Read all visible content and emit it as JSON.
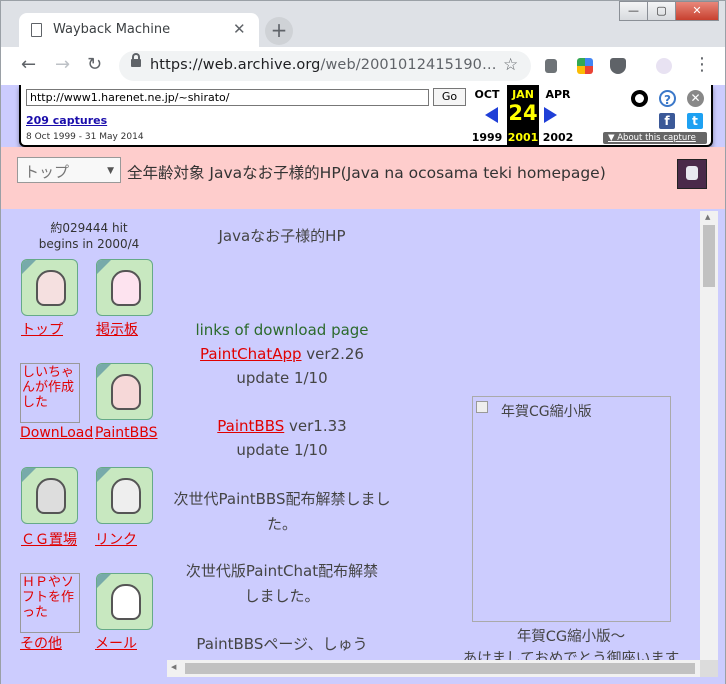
{
  "browser": {
    "tab_title": "Wayback Machine",
    "tab_close": "✕",
    "new_tab": "+",
    "window_min": "—",
    "window_max": "▢",
    "window_close": "✕",
    "back": "←",
    "forward": "→",
    "reload": "↻",
    "url_host": "https://web.archive.org",
    "url_path": "/web/2001012415190…",
    "star": "☆",
    "menu": "⋮"
  },
  "wayback": {
    "url_input": "http://www1.harenet.ne.jp/~shirato/",
    "go": "Go",
    "captures": "209 captures",
    "range": "8 Oct 1999 - 31 May 2014",
    "prev_month": "OCT",
    "prev_year": "1999",
    "cur_month": "JAN",
    "cur_day": "24",
    "cur_year": "2001",
    "next_month": "APR",
    "next_year": "2002",
    "about": "▼ About this capture",
    "help_icon": "?",
    "close_icon": "✕",
    "facebook": "f",
    "twitter": "t"
  },
  "page": {
    "select_value": "トップ",
    "title": "全年齢対象 Javaなお子様的HP(Java na ocosama teki homepage)",
    "hit_count": "約029444 hit",
    "begins": "begins in 2000/4",
    "nav": [
      {
        "label": "トップ"
      },
      {
        "label": "掲示板"
      },
      {
        "label": "DownLoad",
        "alt": "しいちゃんが作成した"
      },
      {
        "label": "PaintBBS"
      },
      {
        "label": "ＣＧ置場"
      },
      {
        "label": "リンク"
      },
      {
        "label": "その他",
        "alt": "ＨＰやソフトを作った"
      },
      {
        "label": "メール"
      }
    ],
    "heading": "Javaなお子様的HP",
    "download_heading": "links of download page",
    "paintchat_link": "PaintChatApp",
    "paintchat_ver": " ver2.26",
    "paintchat_update": "update 1/10",
    "paintbbs_link": "PaintBBS",
    "paintbbs_ver": " ver1.33",
    "paintbbs_update": "update 1/10",
    "news1": "次世代PaintBBS配布解禁しました。",
    "news2": "次世代版PaintChat配布解禁しました。",
    "news3": "PaintBBSページ、しゅう",
    "cg_alt": "年賀CG縮小版",
    "cg_caption": "年賀CG縮小版～",
    "cg_caption2": "あけましておめでとう御座います"
  },
  "colors": {
    "page_bg": "#ccccfe",
    "header_bg": "#fecdcc",
    "link": "#e00000"
  }
}
